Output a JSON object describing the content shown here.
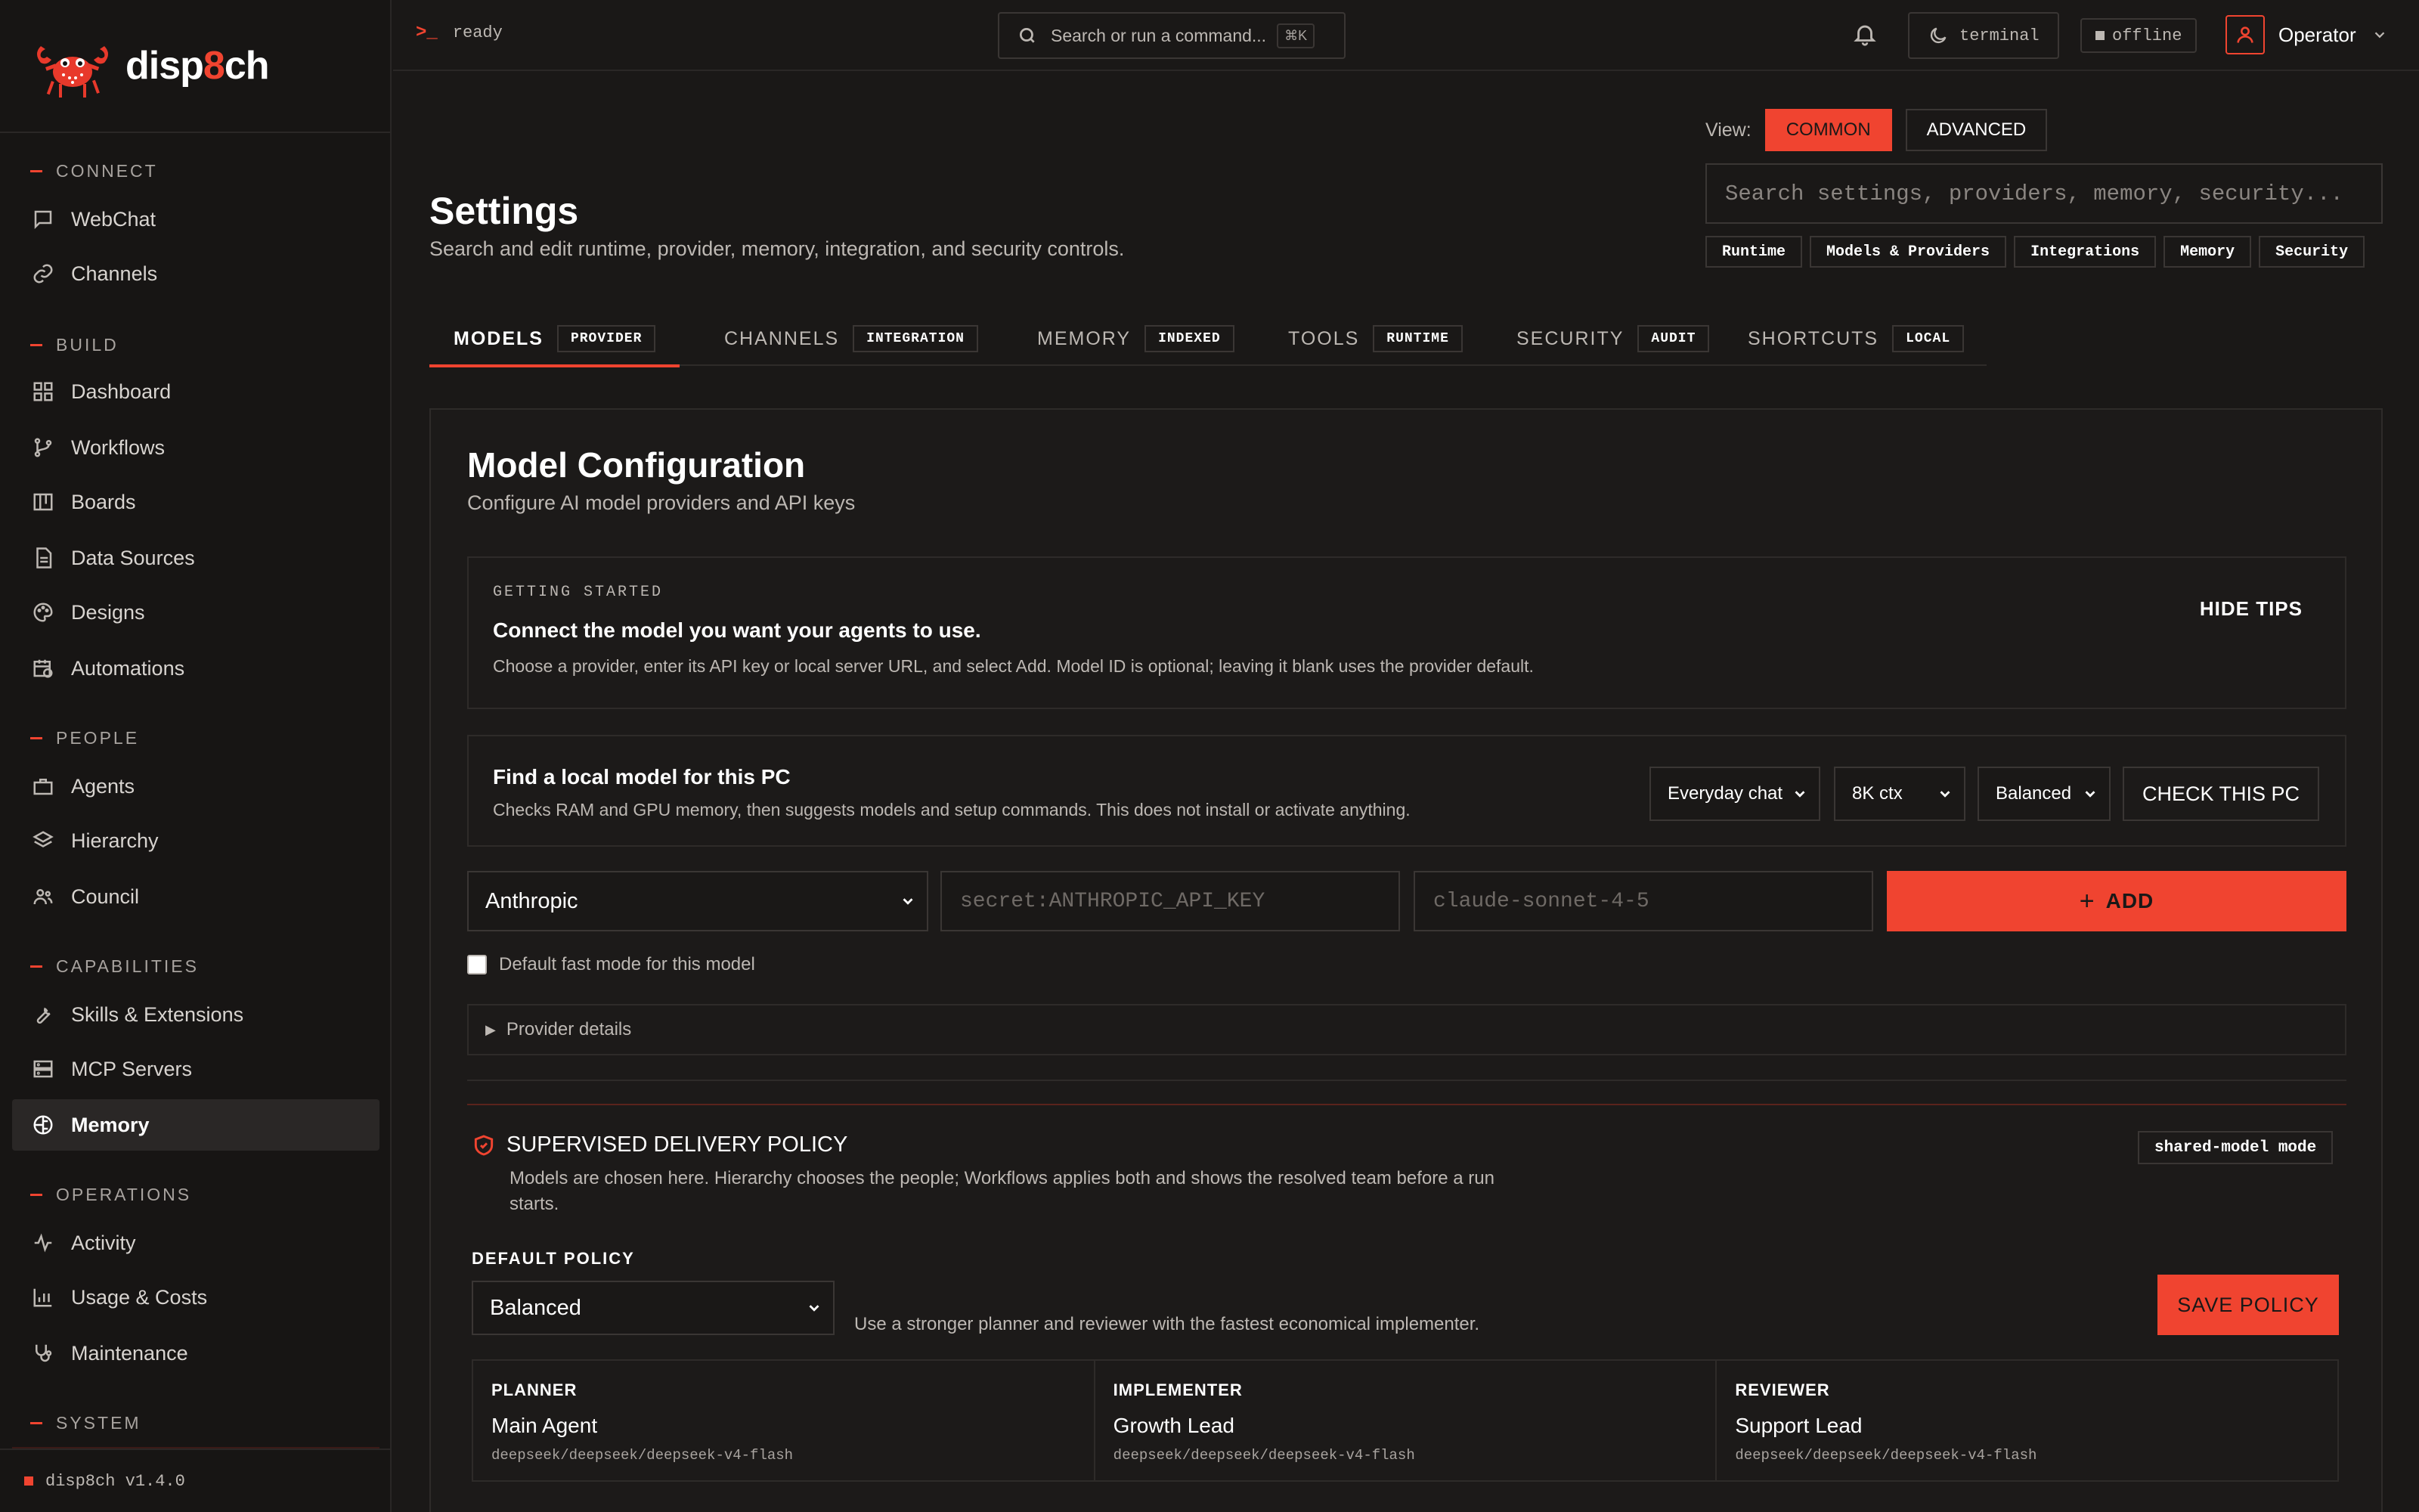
{
  "brand": {
    "name_prefix": "disp",
    "name_accent": "8",
    "name_suffix": "ch"
  },
  "sidebar": {
    "sections": [
      {
        "label": "CONNECT",
        "items": [
          {
            "label": "WebChat",
            "icon": "chat-icon"
          },
          {
            "label": "Channels",
            "icon": "link-icon"
          }
        ]
      },
      {
        "label": "BUILD",
        "items": [
          {
            "label": "Dashboard",
            "icon": "grid-icon"
          },
          {
            "label": "Workflows",
            "icon": "branch-icon"
          },
          {
            "label": "Boards",
            "icon": "board-icon"
          },
          {
            "label": "Data Sources",
            "icon": "file-icon"
          },
          {
            "label": "Designs",
            "icon": "palette-icon"
          },
          {
            "label": "Automations",
            "icon": "calendar-clock-icon"
          }
        ]
      },
      {
        "label": "PEOPLE",
        "items": [
          {
            "label": "Agents",
            "icon": "briefcase-icon"
          },
          {
            "label": "Hierarchy",
            "icon": "layers-icon"
          },
          {
            "label": "Council",
            "icon": "users-icon"
          }
        ]
      },
      {
        "label": "CAPABILITIES",
        "items": [
          {
            "label": "Skills & Extensions",
            "icon": "wrench-icon"
          },
          {
            "label": "MCP Servers",
            "icon": "server-icon"
          },
          {
            "label": "Memory",
            "icon": "brain-icon",
            "active": true
          }
        ]
      },
      {
        "label": "OPERATIONS",
        "items": [
          {
            "label": "Activity",
            "icon": "pulse-icon"
          },
          {
            "label": "Usage & Costs",
            "icon": "bar-chart-icon"
          },
          {
            "label": "Maintenance",
            "icon": "stethoscope-icon"
          }
        ]
      },
      {
        "label": "SYSTEM",
        "items": []
      }
    ],
    "footer_version": "disp8ch v1.4.0"
  },
  "topbar": {
    "status": "ready",
    "command_placeholder": "Search or run a command...",
    "command_shortcut": "⌘K",
    "theme_label": "terminal",
    "connection_label": "offline",
    "user_name": "Operator"
  },
  "page": {
    "title": "Settings",
    "subtitle": "Search and edit runtime, provider, memory, integration, and security controls.",
    "view_label": "View:",
    "view_common": "COMMON",
    "view_advanced": "ADVANCED",
    "search_placeholder": "Search settings, providers, memory, security...",
    "chips": [
      "Runtime",
      "Models & Providers",
      "Integrations",
      "Memory",
      "Security"
    ],
    "tabs": [
      {
        "label": "MODELS",
        "badge": "PROVIDER",
        "active": true
      },
      {
        "label": "CHANNELS",
        "badge": "INTEGRATION"
      },
      {
        "label": "MEMORY",
        "badge": "INDEXED"
      },
      {
        "label": "TOOLS",
        "badge": "RUNTIME"
      },
      {
        "label": "SECURITY",
        "badge": "AUDIT"
      },
      {
        "label": "SHORTCUTS",
        "badge": "LOCAL"
      }
    ]
  },
  "model_config": {
    "title": "Model Configuration",
    "subtitle": "Configure AI model providers and API keys",
    "tips": {
      "kicker": "GETTING STARTED",
      "heading": "Connect the model you want your agents to use.",
      "body": "Choose a provider, enter its API key or local server URL, and select Add. Model ID is optional; leaving it blank uses the provider default.",
      "hide_label": "HIDE TIPS"
    },
    "local_model": {
      "heading": "Find a local model for this PC",
      "body": "Checks RAM and GPU memory, then suggests models and setup commands. This does not install or activate anything.",
      "use_case": "Everyday chat",
      "context": "8K ctx",
      "profile": "Balanced",
      "check_label": "CHECK THIS PC"
    },
    "add_form": {
      "provider": "Anthropic",
      "api_key_placeholder": "secret:ANTHROPIC_API_KEY",
      "model_placeholder": "claude-sonnet-4-5",
      "add_label": "ADD",
      "fast_mode_label": "Default fast mode for this model",
      "fast_mode_checked": false,
      "details_label": "Provider details"
    },
    "policy": {
      "heading": "SUPERVISED DELIVERY POLICY",
      "description": "Models are chosen here. Hierarchy chooses the people; Workflows applies both and shows the resolved team before a run starts.",
      "mode_badge": "shared-model mode",
      "default_label": "DEFAULT POLICY",
      "default_value": "Balanced",
      "default_hint": "Use a stronger planner and reviewer with the fastest economical implementer.",
      "save_label": "SAVE POLICY",
      "roles": [
        {
          "role": "PLANNER",
          "name": "Main Agent",
          "model": "deepseek/deepseek/deepseek-v4-flash"
        },
        {
          "role": "IMPLEMENTER",
          "name": "Growth Lead",
          "model": "deepseek/deepseek/deepseek-v4-flash"
        },
        {
          "role": "REVIEWER",
          "name": "Support Lead",
          "model": "deepseek/deepseek/deepseek-v4-flash"
        }
      ]
    }
  },
  "colors": {
    "accent": "#f04430",
    "background": "#1a1817",
    "sidebar": "#171514",
    "border": "#2e2b29"
  }
}
